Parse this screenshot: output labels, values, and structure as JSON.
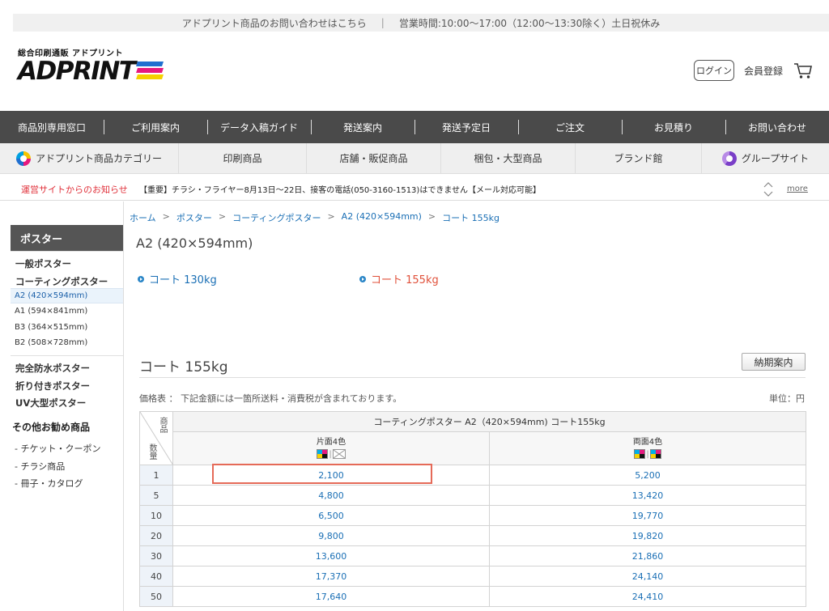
{
  "topbar": {
    "inquiry": "アドプリント商品のお問い合わせはこちら",
    "separator": "|",
    "hours": "営業時間:10:00〜17:00（12:00〜13:30除く）土日祝休み"
  },
  "header": {
    "logo_sub": "総合印刷通販 アドプリント",
    "logo_main": "ADPRINT",
    "login_label": "ログイン",
    "register_label": "会員登録",
    "cart_icon": "cart-icon"
  },
  "nav_primary": [
    "商品別専用窓口",
    "ご利用案内",
    "データ入稿ガイド",
    "発送案内",
    "発送予定日",
    "ご注文",
    "お見積り",
    "お問い合わせ"
  ],
  "nav_secondary": {
    "category_label": "アドプリント商品カテゴリー",
    "items": [
      "印刷商品",
      "店舗・販促商品",
      "梱包・大型商品",
      "ブランド館"
    ],
    "group_label": "グループサイト"
  },
  "notice": {
    "label": "運営サイトからのお知らせ",
    "message": "【重要】チラシ・フライヤー8月13日〜22日、接客の電話(050-3160-1513)はできません【メール対応可能】",
    "more": "more"
  },
  "sidebar": {
    "title": "ポスター",
    "categories": [
      "一般ポスター",
      "コーティングポスター"
    ],
    "sizes": [
      "A2 (420×594mm)",
      "A1 (594×841mm)",
      "B3 (364×515mm)",
      "B2 (508×728mm)"
    ],
    "more_categories": [
      "完全防水ポスター",
      "折り付きポスター",
      "UV大型ポスター"
    ],
    "other_title": "その他お勧め商品",
    "other_items": [
      "- チケット・クーポン",
      "- チラシ商品",
      "- 冊子・カタログ"
    ]
  },
  "breadcrumb": [
    "ホーム",
    "ポスター",
    "コーティングポスター",
    "A2 (420×594mm)",
    "コート 155kg"
  ],
  "page_title": "A2 (420×594mm)",
  "paper_options": [
    {
      "label": "コート 130kg",
      "selected": false
    },
    {
      "label": "コート 155kg",
      "selected": true
    }
  ],
  "section": {
    "title": "コート 155kg",
    "delivery_button": "納期案内",
    "price_note": "価格表 ： 下記金額には一箇所送料・消費税が含まれております。",
    "unit": "単位：円"
  },
  "price_table": {
    "corner_top": "商品",
    "corner_bottom": "数量",
    "header": "コーティングポスター A2（420×594mm) コート155kg",
    "columns": [
      "片面4色",
      "両面4色"
    ],
    "rows": [
      {
        "qty": "1",
        "single": "2,100",
        "double": "5,200"
      },
      {
        "qty": "5",
        "single": "4,800",
        "double": "13,420"
      },
      {
        "qty": "10",
        "single": "6,500",
        "double": "19,770"
      },
      {
        "qty": "20",
        "single": "9,800",
        "double": "19,820"
      },
      {
        "qty": "30",
        "single": "13,600",
        "double": "21,860"
      },
      {
        "qty": "40",
        "single": "17,370",
        "double": "24,140"
      },
      {
        "qty": "50",
        "single": "17,640",
        "double": "24,410"
      }
    ],
    "highlight_color": "#e56a58"
  },
  "colors": {
    "accent_link": "#1a6fb5",
    "selected_option": "#e0503a",
    "nav_dark": "#4a4a4a",
    "notice_red": "#e0303a"
  }
}
